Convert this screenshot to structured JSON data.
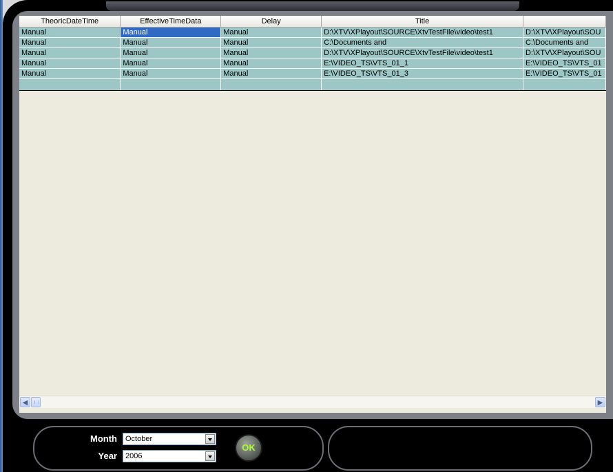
{
  "table": {
    "columns": [
      "TheoricDateTime",
      "EffectiveTimeData",
      "Delay",
      "Title",
      ""
    ],
    "rows": [
      [
        "Manual",
        "Manual",
        "Manual",
        "D:\\XTV\\XPlayout\\SOURCE\\XtvTestFile\\video\\test1",
        "D:\\XTV\\XPlayout\\SOU"
      ],
      [
        "Manual",
        "Manual",
        "Manual",
        "C:\\Documents and",
        "C:\\Documents and"
      ],
      [
        "Manual",
        "Manual",
        "Manual",
        "D:\\XTV\\XPlayout\\SOURCE\\XtvTestFile\\video\\test1",
        "D:\\XTV\\XPlayout\\SOU"
      ],
      [
        "Manual",
        "Manual",
        "Manual",
        "E:\\VIDEO_TS\\VTS_01_1",
        "E:\\VIDEO_TS\\VTS_01"
      ],
      [
        "Manual",
        "Manual",
        "Manual",
        "E:\\VIDEO_TS\\VTS_01_3",
        "E:\\VIDEO_TS\\VTS_01"
      ]
    ]
  },
  "scrollbar": {
    "left_icon": "scroll-left-icon",
    "right_icon": "scroll-right-icon"
  },
  "filters": {
    "month_label": "Month",
    "month_value": "October",
    "year_label": "Year",
    "year_value": "2006",
    "ok_label": "OK"
  },
  "colors": {
    "row_bg": "#9cc7c6",
    "selection": "#316ac5",
    "ok_text": "#a8ff2c"
  }
}
